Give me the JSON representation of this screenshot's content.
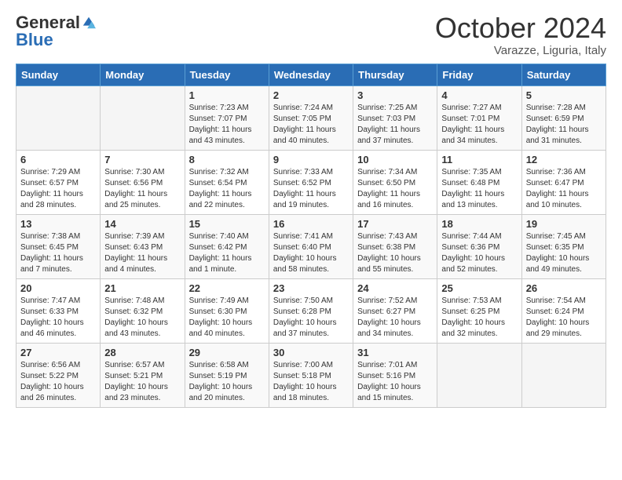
{
  "header": {
    "logo_general": "General",
    "logo_blue": "Blue",
    "month_title": "October 2024",
    "subtitle": "Varazze, Liguria, Italy"
  },
  "days_of_week": [
    "Sunday",
    "Monday",
    "Tuesday",
    "Wednesday",
    "Thursday",
    "Friday",
    "Saturday"
  ],
  "weeks": [
    [
      {
        "day": "",
        "info": ""
      },
      {
        "day": "",
        "info": ""
      },
      {
        "day": "1",
        "info": "Sunrise: 7:23 AM\nSunset: 7:07 PM\nDaylight: 11 hours and 43 minutes."
      },
      {
        "day": "2",
        "info": "Sunrise: 7:24 AM\nSunset: 7:05 PM\nDaylight: 11 hours and 40 minutes."
      },
      {
        "day": "3",
        "info": "Sunrise: 7:25 AM\nSunset: 7:03 PM\nDaylight: 11 hours and 37 minutes."
      },
      {
        "day": "4",
        "info": "Sunrise: 7:27 AM\nSunset: 7:01 PM\nDaylight: 11 hours and 34 minutes."
      },
      {
        "day": "5",
        "info": "Sunrise: 7:28 AM\nSunset: 6:59 PM\nDaylight: 11 hours and 31 minutes."
      }
    ],
    [
      {
        "day": "6",
        "info": "Sunrise: 7:29 AM\nSunset: 6:57 PM\nDaylight: 11 hours and 28 minutes."
      },
      {
        "day": "7",
        "info": "Sunrise: 7:30 AM\nSunset: 6:56 PM\nDaylight: 11 hours and 25 minutes."
      },
      {
        "day": "8",
        "info": "Sunrise: 7:32 AM\nSunset: 6:54 PM\nDaylight: 11 hours and 22 minutes."
      },
      {
        "day": "9",
        "info": "Sunrise: 7:33 AM\nSunset: 6:52 PM\nDaylight: 11 hours and 19 minutes."
      },
      {
        "day": "10",
        "info": "Sunrise: 7:34 AM\nSunset: 6:50 PM\nDaylight: 11 hours and 16 minutes."
      },
      {
        "day": "11",
        "info": "Sunrise: 7:35 AM\nSunset: 6:48 PM\nDaylight: 11 hours and 13 minutes."
      },
      {
        "day": "12",
        "info": "Sunrise: 7:36 AM\nSunset: 6:47 PM\nDaylight: 11 hours and 10 minutes."
      }
    ],
    [
      {
        "day": "13",
        "info": "Sunrise: 7:38 AM\nSunset: 6:45 PM\nDaylight: 11 hours and 7 minutes."
      },
      {
        "day": "14",
        "info": "Sunrise: 7:39 AM\nSunset: 6:43 PM\nDaylight: 11 hours and 4 minutes."
      },
      {
        "day": "15",
        "info": "Sunrise: 7:40 AM\nSunset: 6:42 PM\nDaylight: 11 hours and 1 minute."
      },
      {
        "day": "16",
        "info": "Sunrise: 7:41 AM\nSunset: 6:40 PM\nDaylight: 10 hours and 58 minutes."
      },
      {
        "day": "17",
        "info": "Sunrise: 7:43 AM\nSunset: 6:38 PM\nDaylight: 10 hours and 55 minutes."
      },
      {
        "day": "18",
        "info": "Sunrise: 7:44 AM\nSunset: 6:36 PM\nDaylight: 10 hours and 52 minutes."
      },
      {
        "day": "19",
        "info": "Sunrise: 7:45 AM\nSunset: 6:35 PM\nDaylight: 10 hours and 49 minutes."
      }
    ],
    [
      {
        "day": "20",
        "info": "Sunrise: 7:47 AM\nSunset: 6:33 PM\nDaylight: 10 hours and 46 minutes."
      },
      {
        "day": "21",
        "info": "Sunrise: 7:48 AM\nSunset: 6:32 PM\nDaylight: 10 hours and 43 minutes."
      },
      {
        "day": "22",
        "info": "Sunrise: 7:49 AM\nSunset: 6:30 PM\nDaylight: 10 hours and 40 minutes."
      },
      {
        "day": "23",
        "info": "Sunrise: 7:50 AM\nSunset: 6:28 PM\nDaylight: 10 hours and 37 minutes."
      },
      {
        "day": "24",
        "info": "Sunrise: 7:52 AM\nSunset: 6:27 PM\nDaylight: 10 hours and 34 minutes."
      },
      {
        "day": "25",
        "info": "Sunrise: 7:53 AM\nSunset: 6:25 PM\nDaylight: 10 hours and 32 minutes."
      },
      {
        "day": "26",
        "info": "Sunrise: 7:54 AM\nSunset: 6:24 PM\nDaylight: 10 hours and 29 minutes."
      }
    ],
    [
      {
        "day": "27",
        "info": "Sunrise: 6:56 AM\nSunset: 5:22 PM\nDaylight: 10 hours and 26 minutes."
      },
      {
        "day": "28",
        "info": "Sunrise: 6:57 AM\nSunset: 5:21 PM\nDaylight: 10 hours and 23 minutes."
      },
      {
        "day": "29",
        "info": "Sunrise: 6:58 AM\nSunset: 5:19 PM\nDaylight: 10 hours and 20 minutes."
      },
      {
        "day": "30",
        "info": "Sunrise: 7:00 AM\nSunset: 5:18 PM\nDaylight: 10 hours and 18 minutes."
      },
      {
        "day": "31",
        "info": "Sunrise: 7:01 AM\nSunset: 5:16 PM\nDaylight: 10 hours and 15 minutes."
      },
      {
        "day": "",
        "info": ""
      },
      {
        "day": "",
        "info": ""
      }
    ]
  ]
}
